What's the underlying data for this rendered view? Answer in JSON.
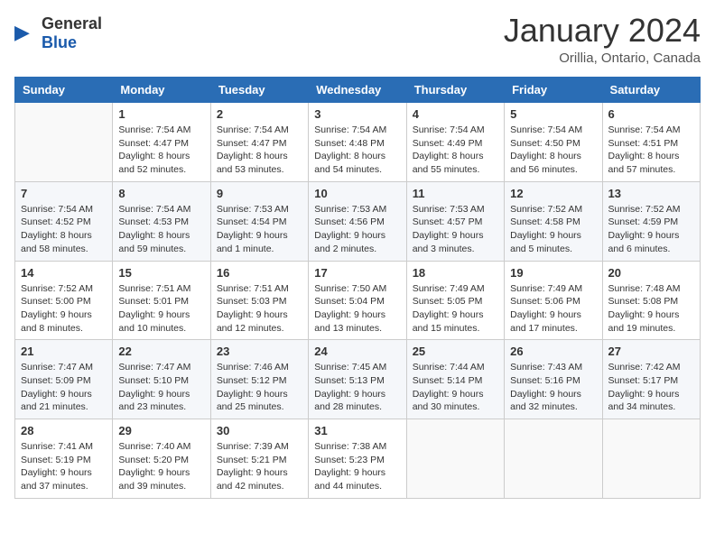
{
  "header": {
    "logo_general": "General",
    "logo_blue": "Blue",
    "month": "January 2024",
    "location": "Orillia, Ontario, Canada"
  },
  "days_of_week": [
    "Sunday",
    "Monday",
    "Tuesday",
    "Wednesday",
    "Thursday",
    "Friday",
    "Saturday"
  ],
  "weeks": [
    [
      {
        "day": "",
        "info": ""
      },
      {
        "day": "1",
        "info": "Sunrise: 7:54 AM\nSunset: 4:47 PM\nDaylight: 8 hours and 52 minutes."
      },
      {
        "day": "2",
        "info": "Sunrise: 7:54 AM\nSunset: 4:47 PM\nDaylight: 8 hours and 53 minutes."
      },
      {
        "day": "3",
        "info": "Sunrise: 7:54 AM\nSunset: 4:48 PM\nDaylight: 8 hours and 54 minutes."
      },
      {
        "day": "4",
        "info": "Sunrise: 7:54 AM\nSunset: 4:49 PM\nDaylight: 8 hours and 55 minutes."
      },
      {
        "day": "5",
        "info": "Sunrise: 7:54 AM\nSunset: 4:50 PM\nDaylight: 8 hours and 56 minutes."
      },
      {
        "day": "6",
        "info": "Sunrise: 7:54 AM\nSunset: 4:51 PM\nDaylight: 8 hours and 57 minutes."
      }
    ],
    [
      {
        "day": "7",
        "info": "Sunrise: 7:54 AM\nSunset: 4:52 PM\nDaylight: 8 hours and 58 minutes."
      },
      {
        "day": "8",
        "info": "Sunrise: 7:54 AM\nSunset: 4:53 PM\nDaylight: 8 hours and 59 minutes."
      },
      {
        "day": "9",
        "info": "Sunrise: 7:53 AM\nSunset: 4:54 PM\nDaylight: 9 hours and 1 minute."
      },
      {
        "day": "10",
        "info": "Sunrise: 7:53 AM\nSunset: 4:56 PM\nDaylight: 9 hours and 2 minutes."
      },
      {
        "day": "11",
        "info": "Sunrise: 7:53 AM\nSunset: 4:57 PM\nDaylight: 9 hours and 3 minutes."
      },
      {
        "day": "12",
        "info": "Sunrise: 7:52 AM\nSunset: 4:58 PM\nDaylight: 9 hours and 5 minutes."
      },
      {
        "day": "13",
        "info": "Sunrise: 7:52 AM\nSunset: 4:59 PM\nDaylight: 9 hours and 6 minutes."
      }
    ],
    [
      {
        "day": "14",
        "info": "Sunrise: 7:52 AM\nSunset: 5:00 PM\nDaylight: 9 hours and 8 minutes."
      },
      {
        "day": "15",
        "info": "Sunrise: 7:51 AM\nSunset: 5:01 PM\nDaylight: 9 hours and 10 minutes."
      },
      {
        "day": "16",
        "info": "Sunrise: 7:51 AM\nSunset: 5:03 PM\nDaylight: 9 hours and 12 minutes."
      },
      {
        "day": "17",
        "info": "Sunrise: 7:50 AM\nSunset: 5:04 PM\nDaylight: 9 hours and 13 minutes."
      },
      {
        "day": "18",
        "info": "Sunrise: 7:49 AM\nSunset: 5:05 PM\nDaylight: 9 hours and 15 minutes."
      },
      {
        "day": "19",
        "info": "Sunrise: 7:49 AM\nSunset: 5:06 PM\nDaylight: 9 hours and 17 minutes."
      },
      {
        "day": "20",
        "info": "Sunrise: 7:48 AM\nSunset: 5:08 PM\nDaylight: 9 hours and 19 minutes."
      }
    ],
    [
      {
        "day": "21",
        "info": "Sunrise: 7:47 AM\nSunset: 5:09 PM\nDaylight: 9 hours and 21 minutes."
      },
      {
        "day": "22",
        "info": "Sunrise: 7:47 AM\nSunset: 5:10 PM\nDaylight: 9 hours and 23 minutes."
      },
      {
        "day": "23",
        "info": "Sunrise: 7:46 AM\nSunset: 5:12 PM\nDaylight: 9 hours and 25 minutes."
      },
      {
        "day": "24",
        "info": "Sunrise: 7:45 AM\nSunset: 5:13 PM\nDaylight: 9 hours and 28 minutes."
      },
      {
        "day": "25",
        "info": "Sunrise: 7:44 AM\nSunset: 5:14 PM\nDaylight: 9 hours and 30 minutes."
      },
      {
        "day": "26",
        "info": "Sunrise: 7:43 AM\nSunset: 5:16 PM\nDaylight: 9 hours and 32 minutes."
      },
      {
        "day": "27",
        "info": "Sunrise: 7:42 AM\nSunset: 5:17 PM\nDaylight: 9 hours and 34 minutes."
      }
    ],
    [
      {
        "day": "28",
        "info": "Sunrise: 7:41 AM\nSunset: 5:19 PM\nDaylight: 9 hours and 37 minutes."
      },
      {
        "day": "29",
        "info": "Sunrise: 7:40 AM\nSunset: 5:20 PM\nDaylight: 9 hours and 39 minutes."
      },
      {
        "day": "30",
        "info": "Sunrise: 7:39 AM\nSunset: 5:21 PM\nDaylight: 9 hours and 42 minutes."
      },
      {
        "day": "31",
        "info": "Sunrise: 7:38 AM\nSunset: 5:23 PM\nDaylight: 9 hours and 44 minutes."
      },
      {
        "day": "",
        "info": ""
      },
      {
        "day": "",
        "info": ""
      },
      {
        "day": "",
        "info": ""
      }
    ]
  ]
}
